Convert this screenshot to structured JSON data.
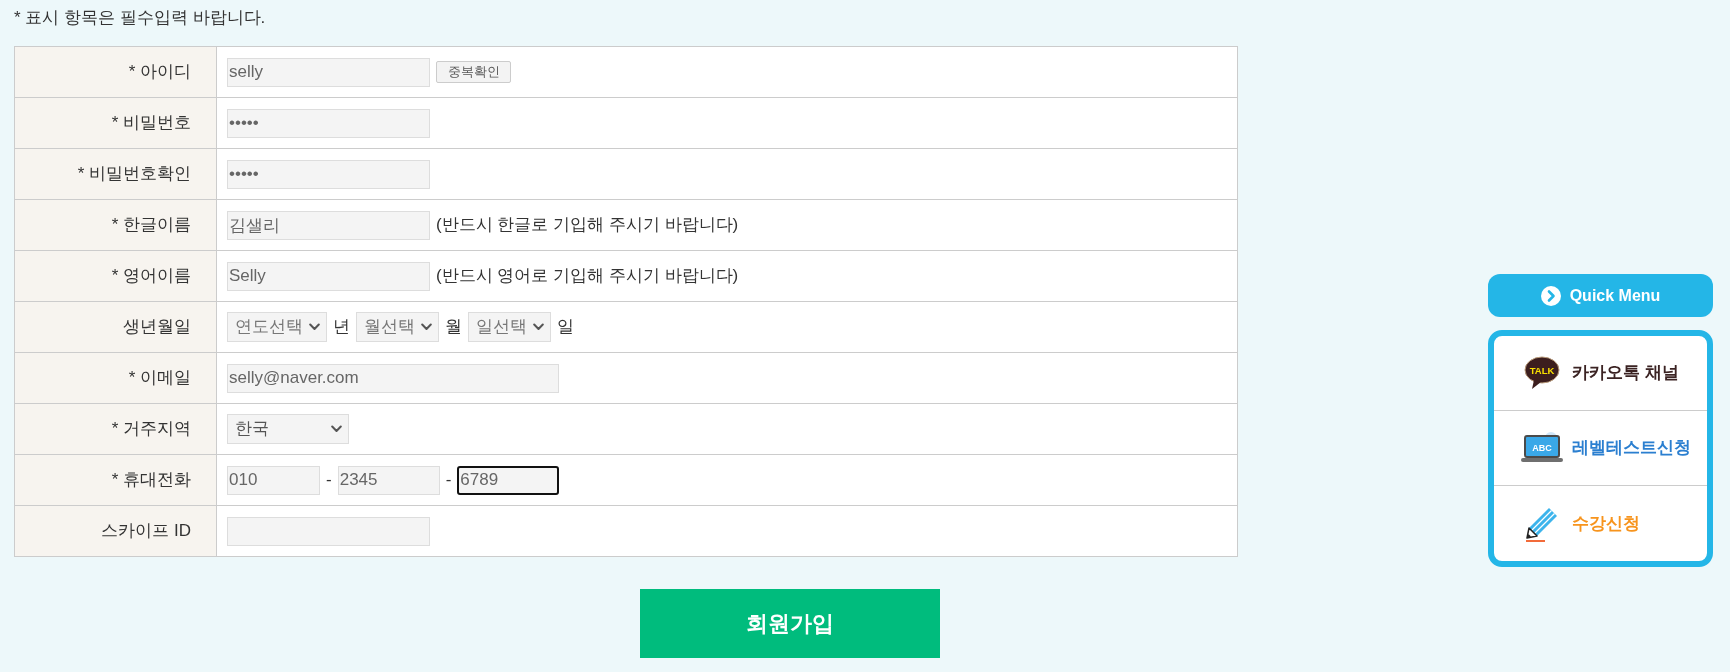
{
  "notice": "* 표시 항목은 필수입력 바랍니다.",
  "form_rows": [
    {
      "label": "* 아이디",
      "controls": [
        {
          "kind": "input",
          "value": "selly",
          "focused": false
        },
        {
          "kind": "button",
          "label": "중복확인"
        }
      ]
    },
    {
      "label": "* 비밀번호",
      "controls": [
        {
          "kind": "password",
          "value": "•••••",
          "focused": false
        }
      ]
    },
    {
      "label": "* 비밀번호확인",
      "controls": [
        {
          "kind": "password",
          "value": "•••••",
          "focused": false
        }
      ]
    },
    {
      "label": "* 한글이름",
      "controls": [
        {
          "kind": "input",
          "value": "김샐리",
          "focused": false
        },
        {
          "kind": "note",
          "text": "(반드시 한글로 기입해 주시기 바랍니다)"
        }
      ]
    },
    {
      "label": "* 영어이름",
      "controls": [
        {
          "kind": "input",
          "value": "Selly",
          "focused": false
        },
        {
          "kind": "note",
          "text": "(반드시 영어로 기입해 주시기 바랍니다)"
        }
      ]
    },
    {
      "label": "생년월일",
      "controls": [
        {
          "kind": "select",
          "value": "연도선택"
        },
        {
          "kind": "unit",
          "text": "년"
        },
        {
          "kind": "select",
          "value": "월선택"
        },
        {
          "kind": "unit",
          "text": "월"
        },
        {
          "kind": "select",
          "value": "일선택"
        },
        {
          "kind": "unit",
          "text": "일"
        }
      ]
    },
    {
      "label": "* 이메일",
      "controls": [
        {
          "kind": "email",
          "value": "selly@naver.com",
          "focused": false
        }
      ]
    },
    {
      "label": "* 거주지역",
      "controls": [
        {
          "kind": "region-select",
          "value": "한국"
        }
      ]
    },
    {
      "label": "* 휴대전화",
      "controls": [
        {
          "kind": "phone",
          "value": "010",
          "focused": false
        },
        {
          "kind": "dash",
          "text": "-"
        },
        {
          "kind": "phone",
          "value": "2345",
          "focused": false
        },
        {
          "kind": "dash",
          "text": "-"
        },
        {
          "kind": "phone",
          "value": "6789",
          "focused": true
        }
      ]
    },
    {
      "label": "스카이프 ID",
      "controls": [
        {
          "kind": "input",
          "focused": false
        }
      ]
    }
  ],
  "submit_button": "회원가입",
  "quick_menu": {
    "title": "Quick Menu",
    "items": [
      {
        "kind": "kakao",
        "label": "카카오톡 채널",
        "icon_text": "TALK"
      },
      {
        "kind": "level-test",
        "label": "레벨테스트신청",
        "icon_text": "ABC"
      },
      {
        "kind": "enroll",
        "label": "수강신청"
      }
    ]
  }
}
